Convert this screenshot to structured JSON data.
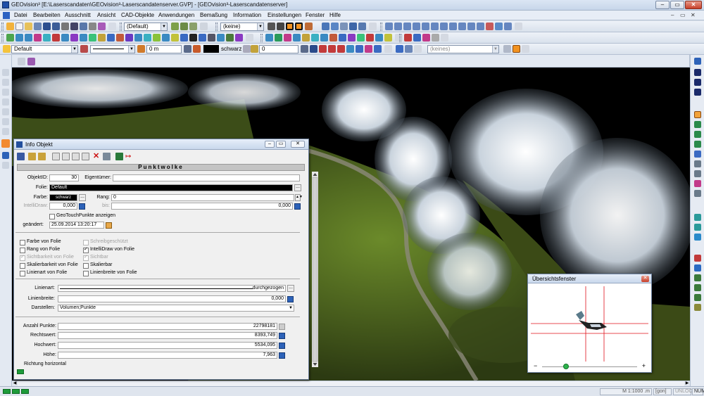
{
  "window": {
    "title": "GEOvision³ [E:\\Laserscandaten\\GEOvision³-Laserscandatenserver.GVP] - [GEOvision³-Laserscandatenserver]"
  },
  "menu": [
    "Datei",
    "Bearbeiten",
    "Ausschnitt",
    "Ansicht",
    "CAD-Objekte",
    "Anwendungen",
    "Bemaßung",
    "Information",
    "Einstellungen",
    "Fenster",
    "Hilfe"
  ],
  "toolbar1": {
    "layer_combo": "(Default)",
    "style_combo": "(keine)"
  },
  "toolbar3": {
    "layer_combo": "Default",
    "value_field": "0 m",
    "color_label": "schwarz",
    "rank_field": "0",
    "keine_combo": "(keines)"
  },
  "dialog": {
    "title": "Info Objekt",
    "banner": "Punktwolke",
    "objekt_id_label": "ObjektID:",
    "objekt_id": "30",
    "eigentuemer_label": "Eigentümer:",
    "eigentuemer": "",
    "folie_label": "Folie:",
    "folie": "Default",
    "farbe_label": "Farbe:",
    "farbe": "schwarz",
    "rang_label": "Rang:",
    "rang": "0",
    "intellidraw_label": "IntelliDraw:",
    "intellidraw": "0,000",
    "bis_label": "bis:",
    "bis": "0,000",
    "geotouch_label": "GeoTouchPunkte anzeigen",
    "geaendert_label": "geändert:",
    "geaendert": "25.09.2014 13:20:17",
    "checkboxes_left": [
      {
        "label": "Farbe von Folie",
        "checked": false,
        "enabled": true
      },
      {
        "label": "Rang von Folie",
        "checked": false,
        "enabled": true
      },
      {
        "label": "Sichtbarkeit von Folie",
        "checked": true,
        "enabled": false
      },
      {
        "label": "Skalierbarkeit von Folie",
        "checked": false,
        "enabled": true
      },
      {
        "label": "Linienart von Folie",
        "checked": false,
        "enabled": true
      }
    ],
    "checkboxes_right": [
      {
        "label": "Schreibgeschützt",
        "checked": false,
        "enabled": false
      },
      {
        "label": "IntelliDraw von Folie",
        "checked": true,
        "enabled": true
      },
      {
        "label": "Sichtbar",
        "checked": true,
        "enabled": false
      },
      {
        "label": "Skalierbar",
        "checked": false,
        "enabled": true
      },
      {
        "label": "Linienbreite von Folie",
        "checked": false,
        "enabled": true
      }
    ],
    "linienart_label": "Linienart:",
    "linienart": "durchgezogen",
    "linienbreite_label": "Linienbreite:",
    "linienbreite": "0,000",
    "darstellen_label": "Darstellen:",
    "darstellen": "Volumen;Punkte",
    "anzahl_label": "Anzahl Punkte:",
    "anzahl": "22798181",
    "rechtswert_label": "Rechtswert:",
    "rechtswert": "8393,749",
    "hochwert_label": "Hochwert:",
    "hochwert": "5534,095",
    "hoehe_label": "Höhe:",
    "hoehe": "7,963",
    "richtung_label": "Richtung horizontal"
  },
  "overview": {
    "title": "Übersichtsfenster",
    "zoom_level": 0.25
  },
  "statusbar": {
    "scale": "M 1:1000 .m",
    "angle_unit": "[gon]",
    "unlock": "UNLOCK",
    "num": "NUM"
  },
  "colors": {
    "viewport_bg": "#000000",
    "crosshair": "#e0101a",
    "accent": "#2d62b8"
  }
}
